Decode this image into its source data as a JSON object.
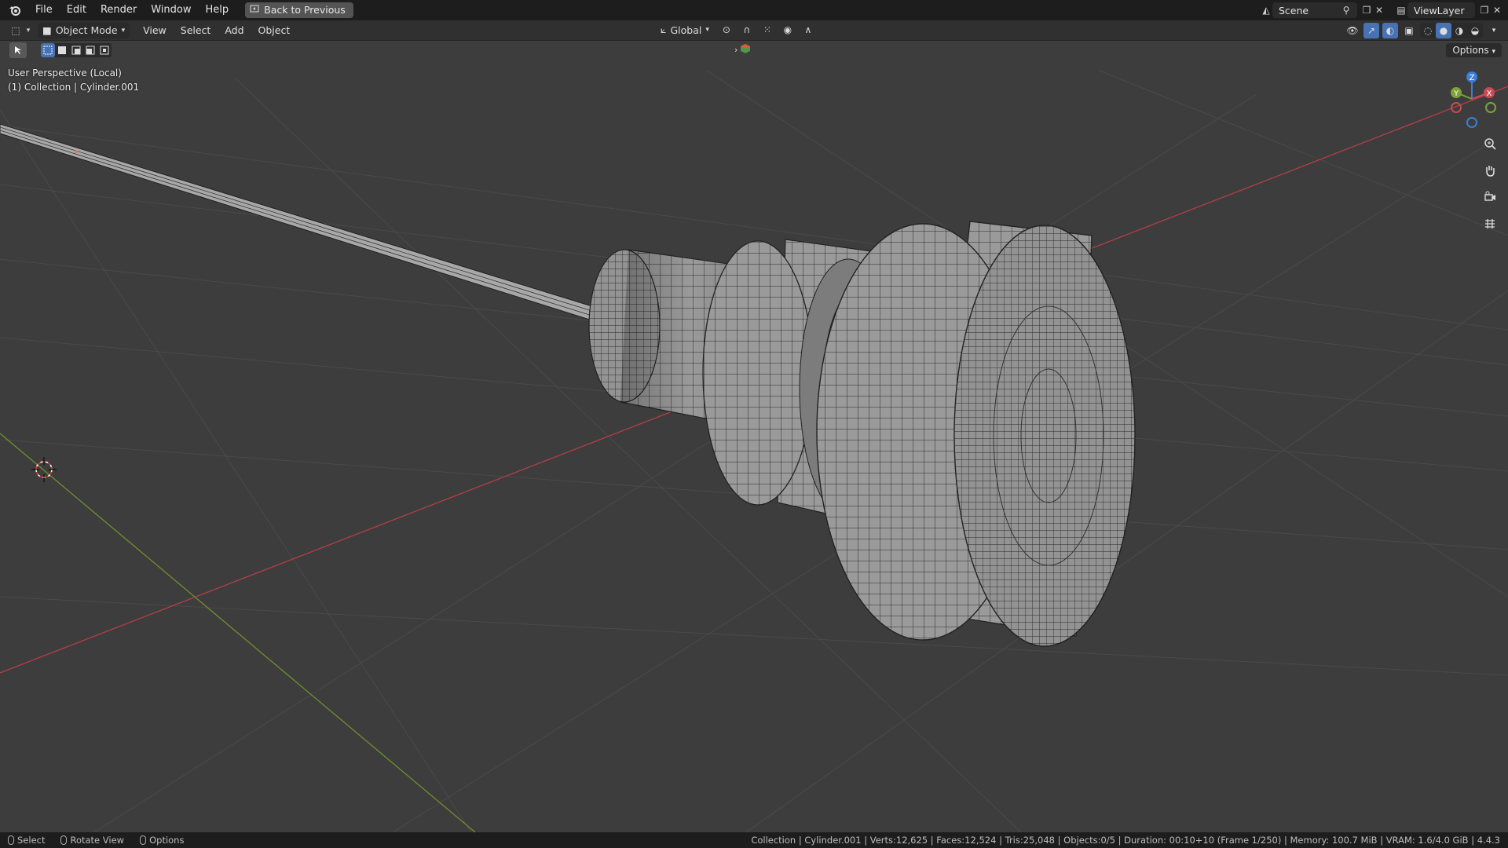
{
  "topbar": {
    "menus": [
      "File",
      "Edit",
      "Render",
      "Window",
      "Help"
    ],
    "back_label": "Back to Previous",
    "scene_value": "Scene",
    "viewlayer_value": "ViewLayer"
  },
  "header": {
    "mode_label": "Object Mode",
    "menus": [
      "View",
      "Select",
      "Add",
      "Object"
    ],
    "orientation_label": "Global",
    "options_label": "Options"
  },
  "viewport": {
    "perspective_label": "User Perspective (Local)",
    "collection_label": "(1) Collection | Cylinder.001",
    "gizmo_axes": [
      "Z",
      "Y",
      "X"
    ]
  },
  "statusbar": {
    "hints": [
      "Select",
      "Rotate View",
      "Options"
    ],
    "stats": "Collection | Cylinder.001 | Verts:12,625 | Faces:12,524 | Tris:25,048 | Objects:0/5 | Duration: 00:10+10 (Frame 1/250) | Memory: 100.7 MiB | VRAM: 1.6/4.0 GiB | 4.4.3"
  },
  "colors": {
    "x_axis": "#c84a55",
    "y_axis": "#7ea23a",
    "z_axis": "#3d7ed6",
    "accent": "#4772b3",
    "grid": "#4a4a4a",
    "viewport_bg": "#3d3d3d"
  }
}
